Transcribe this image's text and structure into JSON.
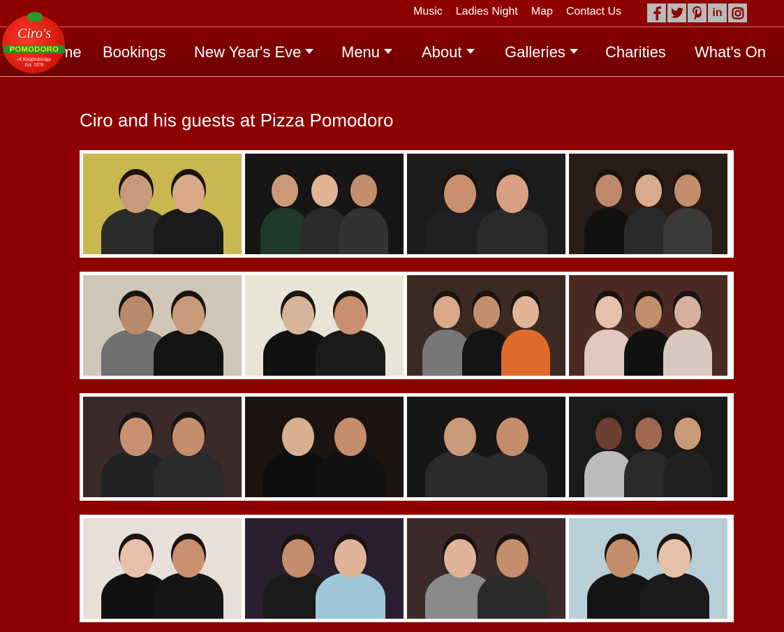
{
  "top_links": [
    "Music",
    "Ladies Night",
    "Map",
    "Contact Us"
  ],
  "social": [
    {
      "icon": "facebook-icon",
      "glyph": "f"
    },
    {
      "icon": "twitter-icon",
      "glyph": "t"
    },
    {
      "icon": "pinterest-icon",
      "glyph": "p"
    },
    {
      "icon": "linkedin-icon",
      "glyph": "in"
    },
    {
      "icon": "instagram-icon",
      "glyph": "◎"
    }
  ],
  "logo": {
    "line1": "Ciro's",
    "line2": "POMODORO",
    "line3": "of Knightsbridge",
    "line4": "Est. 1978"
  },
  "nav": [
    {
      "label": "Home",
      "visible_text": "me",
      "dropdown": false
    },
    {
      "label": "Bookings",
      "dropdown": false
    },
    {
      "label": "New Year's Eve",
      "dropdown": true
    },
    {
      "label": "Menu",
      "dropdown": true
    },
    {
      "label": "About",
      "dropdown": true
    },
    {
      "label": "Galleries",
      "dropdown": true
    },
    {
      "label": "Charities",
      "dropdown": false
    },
    {
      "label": "What's On",
      "dropdown": false
    }
  ],
  "page_title": "Ciro and his guests at Pizza Pomodoro",
  "colors": {
    "background": "#8f0000",
    "nav_dark": "#6f0000",
    "photo_frame": "#ffffff"
  },
  "gallery_rows": [
    [
      {
        "bg": "#c9b84f",
        "people": [
          [
            "#2b2b2b",
            "#c99a7a"
          ],
          [
            "#1a1a1a",
            "#d8a888"
          ]
        ]
      },
      {
        "bg": "#161616",
        "people": [
          [
            "#1f3a2a",
            "#c99a7a"
          ],
          [
            "#2a2a2a",
            "#e2b496"
          ],
          [
            "#333",
            "#c48e6c"
          ]
        ]
      },
      {
        "bg": "#1c1c1c",
        "people": [
          [
            "#202020",
            "#c99070"
          ],
          [
            "#2a2a2a",
            "#d8a080"
          ]
        ]
      },
      {
        "bg": "#2a1d18",
        "people": [
          [
            "#111",
            "#c08868"
          ],
          [
            "#2a2a2a",
            "#d9ab8a"
          ],
          [
            "#3a3a3a",
            "#c48e6c"
          ]
        ]
      }
    ],
    [
      {
        "bg": "#cfc6b8",
        "people": [
          [
            "#6f6f6f",
            "#b98a6a"
          ],
          [
            "#141414",
            "#c99a7a"
          ]
        ]
      },
      {
        "bg": "#e8e4d6",
        "people": [
          [
            "#111",
            "#d5b49a"
          ],
          [
            "#1a1a1a",
            "#c99070"
          ]
        ]
      },
      {
        "bg": "#3b2a22",
        "people": [
          [
            "#777",
            "#d8a888"
          ],
          [
            "#141414",
            "#c48e6c"
          ],
          [
            "#e06a2a",
            "#e2b496"
          ]
        ]
      },
      {
        "bg": "#4a2a22",
        "people": [
          [
            "#e0c8c0",
            "#e6c0a8"
          ],
          [
            "#111",
            "#c48e6c"
          ],
          [
            "#d8c8c0",
            "#d8b0a0"
          ]
        ]
      }
    ],
    [
      {
        "bg": "#3a2a2a",
        "people": [
          [
            "#222",
            "#c99070"
          ],
          [
            "#2a2a2a",
            "#c48e6c"
          ]
        ]
      },
      {
        "bg": "#1c1410",
        "people": [
          [
            "#0e0e0e",
            "#d8b090"
          ],
          [
            "#111",
            "#c48e6c"
          ]
        ]
      },
      {
        "bg": "#161616",
        "people": [
          [
            "#2b2b2b",
            "#c99a7a"
          ],
          [
            "#2a2a2a",
            "#c48e6c"
          ]
        ]
      },
      {
        "bg": "#1a1a1a",
        "people": [
          [
            "#bbb",
            "#6a4030"
          ],
          [
            "#2a2a2a",
            "#a06850"
          ],
          [
            "#222",
            "#c99a7a"
          ]
        ]
      }
    ],
    [
      {
        "bg": "#e8e0d8",
        "people": [
          [
            "#111",
            "#e6c0a8"
          ],
          [
            "#151515",
            "#c99070"
          ]
        ]
      },
      {
        "bg": "#2a1f30",
        "people": [
          [
            "#1a1a1a",
            "#c48e6c"
          ],
          [
            "#9ec7d8",
            "#e0b498"
          ]
        ]
      },
      {
        "bg": "#3a2a2a",
        "people": [
          [
            "#8a8a8a",
            "#e0b498"
          ],
          [
            "#2a2a2a",
            "#c48e6c"
          ]
        ]
      },
      {
        "bg": "#b8cfd8",
        "people": [
          [
            "#151515",
            "#c48e6c"
          ],
          [
            "#1a1a1a",
            "#e6c0a8"
          ]
        ]
      }
    ]
  ]
}
